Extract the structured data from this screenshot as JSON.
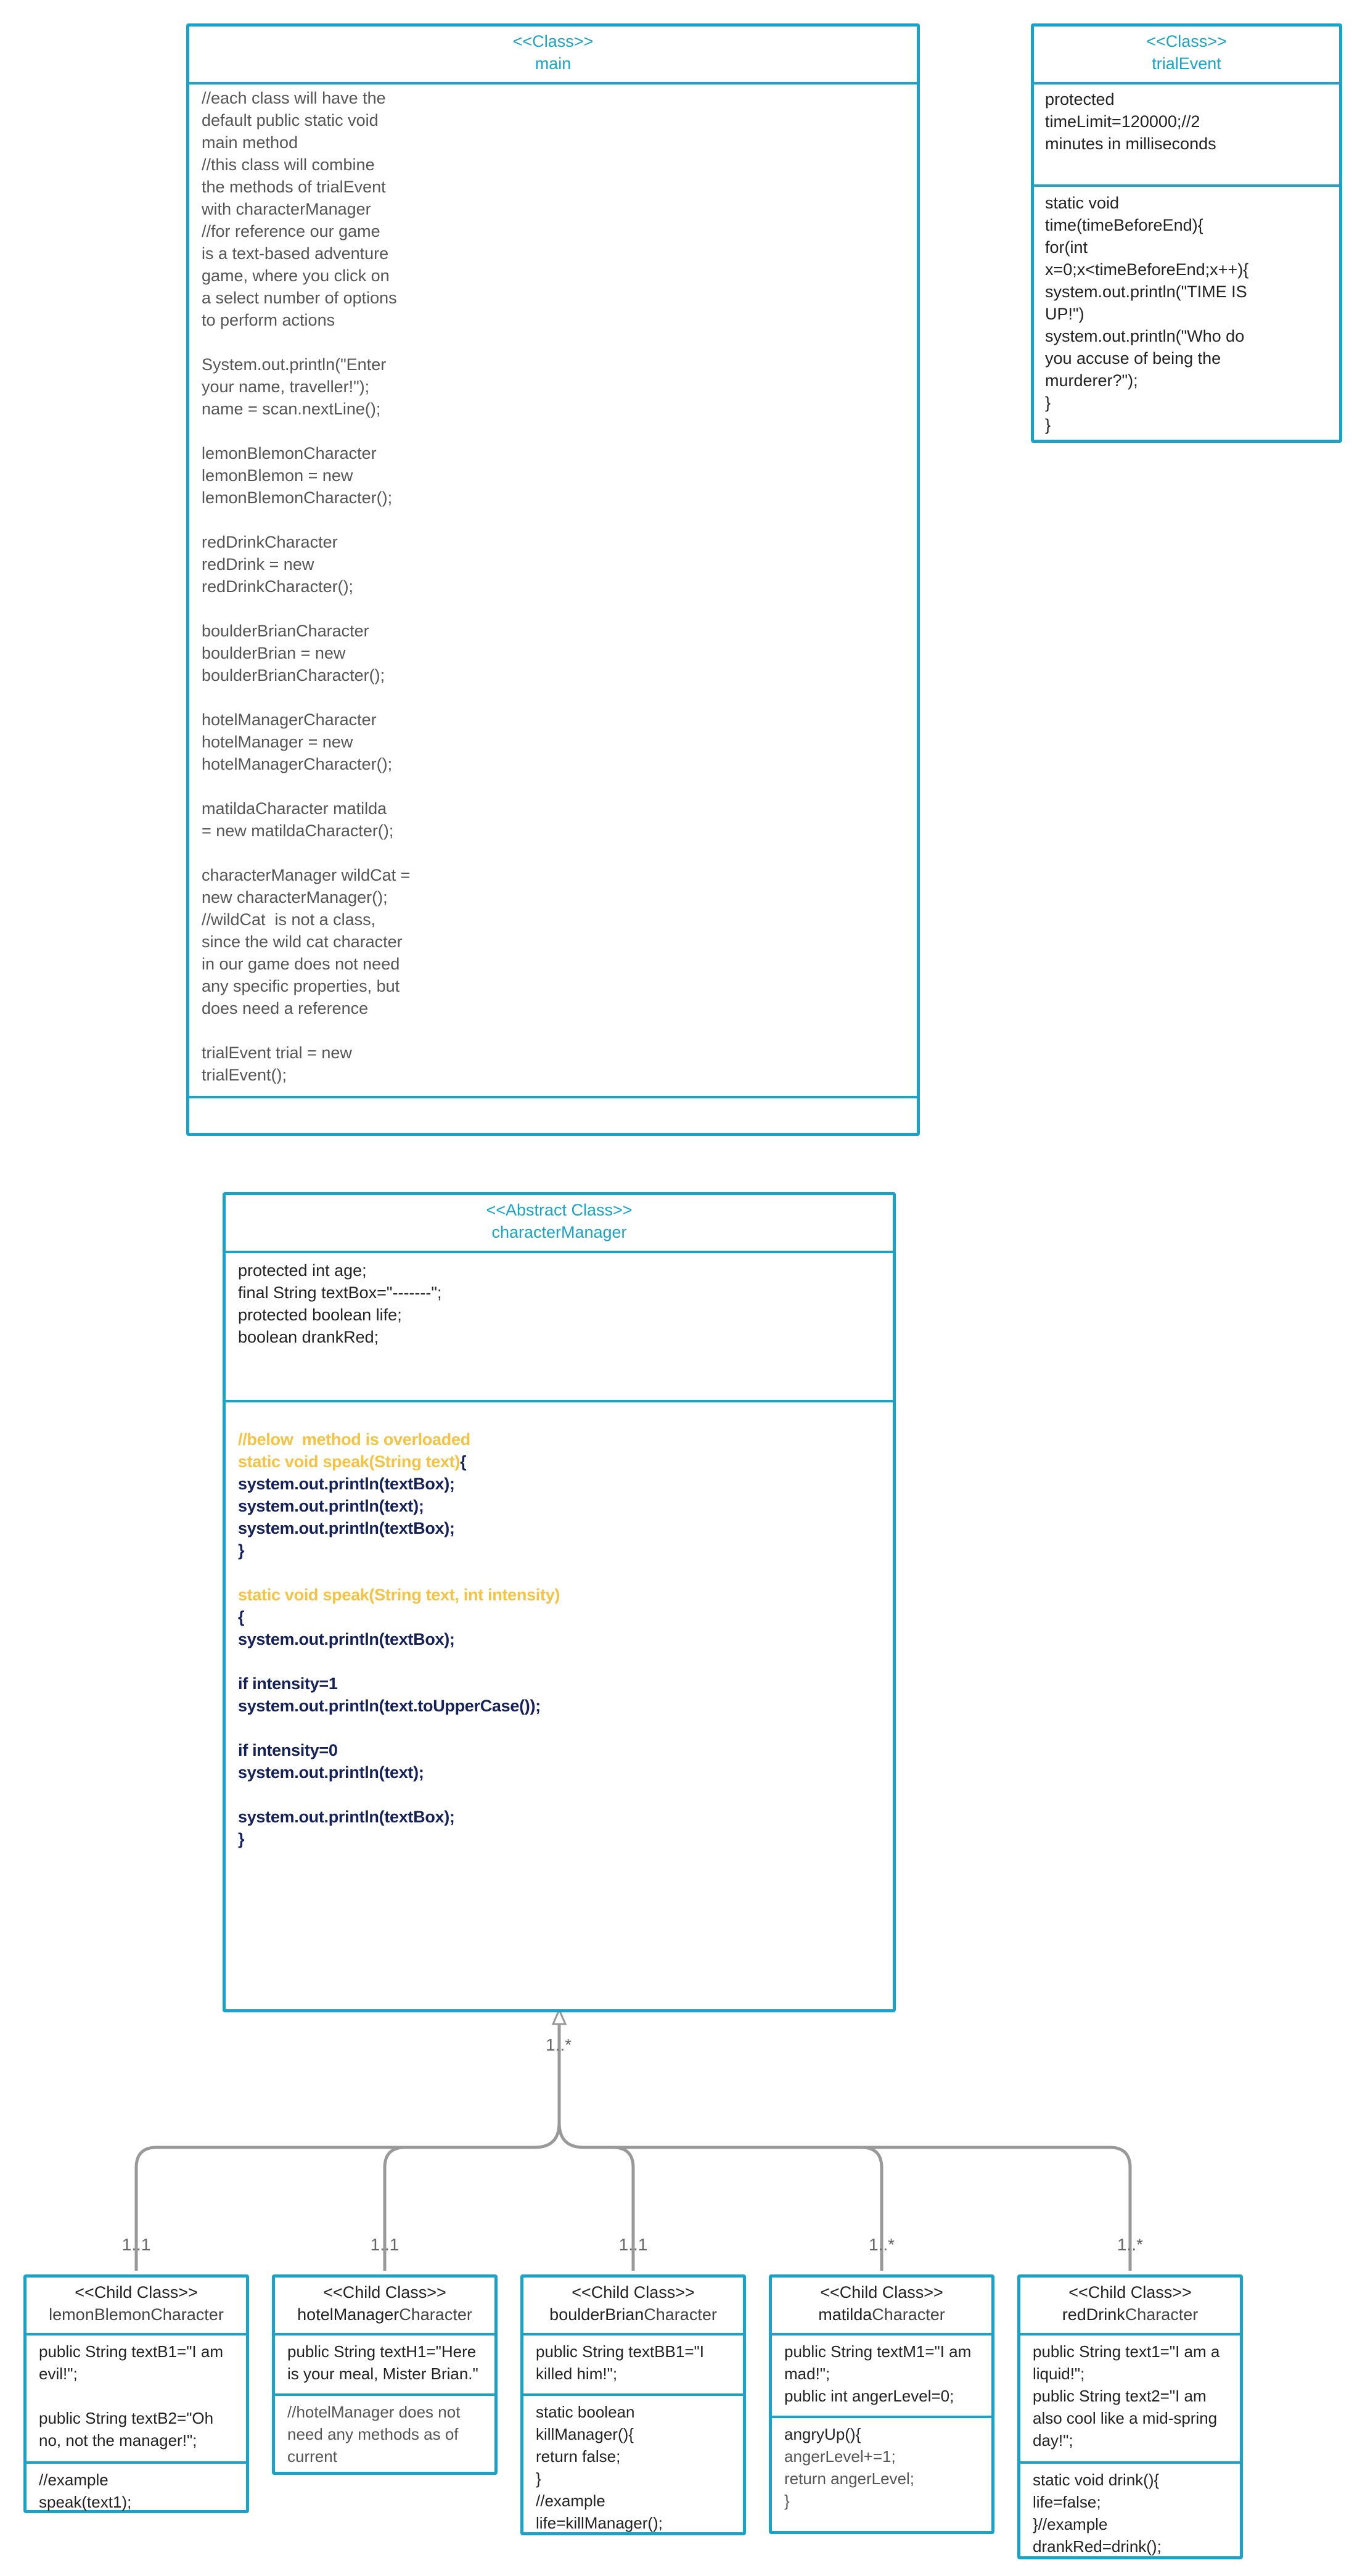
{
  "main": {
    "stereotype": "<<Class>>",
    "name": "main",
    "body": "//each class will have the\ndefault public static void\nmain method\n//this class will combine\nthe methods of trialEvent\nwith characterManager\n//for reference our game\nis a text-based adventure\ngame, where you click on\na select number of options\nto perform actions\n\nSystem.out.println(\"Enter\nyour name, traveller!\");\nname = scan.nextLine();\n\nlemonBlemonCharacter\nlemonBlemon = new\nlemonBlemonCharacter();\n\nredDrinkCharacter\nredDrink = new\nredDrinkCharacter();\n\nboulderBrianCharacter\nboulderBrian = new\nboulderBrianCharacter();\n\nhotelManagerCharacter\nhotelManager = new\nhotelManagerCharacter();\n\nmatildaCharacter matilda\n= new matildaCharacter();\n\ncharacterManager wildCat =\nnew characterManager();\n//wildCat  is not a class,\nsince the wild cat character\nin our game does not need\nany specific properties, but\ndoes need a reference\n\ntrialEvent trial = new\ntrialEvent();"
  },
  "trialEvent": {
    "stereotype": "<<Class>>",
    "name": "trialEvent",
    "attributes": "protected\ntimeLimit=120000;//2\nminutes in milliseconds",
    "methods": "static void\ntime(timeBeforeEnd){\nfor(int\nx=0;x<timeBeforeEnd;x++){\nsystem.out.println(\"TIME IS\nUP!\")\nsystem.out.println(\"Who do\nyou accuse of being the\nmurderer?\");\n}\n}"
  },
  "characterManager": {
    "stereotype": "<<Abstract Class>>",
    "name": "characterManager",
    "attributes": "protected int age;\nfinal String textBox=\"-------\";\nprotected boolean life;\nboolean drankRed;",
    "m_comment": "//below  method is overloaded",
    "m_sig1": "static void speak(String text)",
    "m_brace1": "{",
    "m_body1": "system.out.println(textBox);\nsystem.out.println(text);\nsystem.out.println(textBox);\n}",
    "m_sig2": "static void speak(String text, int intensity)",
    "m_body2": "{\nsystem.out.println(textBox);\n\nif intensity=1\nsystem.out.println(text.toUpperCase());\n\nif intensity=0\nsystem.out.println(text);\n\nsystem.out.println(textBox);\n}"
  },
  "multiplicity": {
    "parent": "1..*",
    "lemon": "1..1",
    "hotel": "1..1",
    "boulder": "1..1",
    "matilda": "1..*",
    "red": "1..*"
  },
  "children": {
    "lemon": {
      "stereotype": "<<Child Class>>",
      "name": "lemonBlemonCharacter",
      "attributes": "public String textB1=\"I am\nevil!\";\n\npublic String textB2=\"Oh\nno, not the manager!\";",
      "methods": "//example\nspeak(text1);"
    },
    "hotel": {
      "stereotype": "<<Child Class>>",
      "name_a": "hotelManager",
      "name_b": "Character",
      "attributes": "public String textH1=\"Here\nis your meal, Mister Brian.\"",
      "methods": "//hotelManager does not\nneed any methods as of\ncurrent"
    },
    "boulder": {
      "stereotype": "<<Child Class>>",
      "name_a": "boulderBrian",
      "name_b": "Character",
      "attributes": "public String textBB1=\"I\nkilled him!\";",
      "methods": "static boolean\nkillManager(){\nreturn false;\n}\n//example\nlife=killManager();"
    },
    "matilda": {
      "stereotype": "<<Child Class>>",
      "name_a": "matilda",
      "name_b": "Character",
      "attributes": "public String textM1=\"I am\nmad!\";\npublic int angerLevel=0;",
      "methods_a": "angryUp(){",
      "methods_b": "angerLevel+=1;\nreturn angerLevel;\n}"
    },
    "red": {
      "stereotype": "<<Child Class>>",
      "name_a": "redDrink",
      "name_b": "Character",
      "attributes": "public String text1=\"I am a\nliquid!\";\npublic String text2=\"I am\nalso cool like a mid-spring\nday!\";",
      "methods": "static void drink(){\nlife=false;\n}//example\ndrankRed=drink();"
    }
  },
  "colors": {
    "border": "#1aa3c9",
    "highlight": "#f5c242",
    "code": "#14215a",
    "connector": "#999999"
  }
}
